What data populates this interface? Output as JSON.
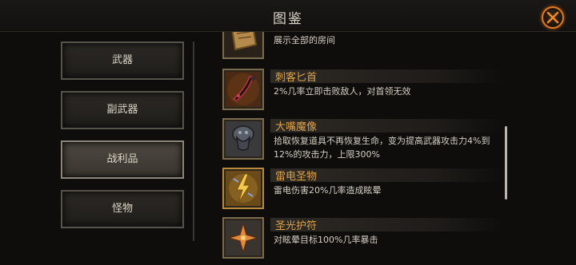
{
  "header": {
    "title": "图鉴"
  },
  "menu": {
    "items": [
      {
        "label": "武器",
        "active": false
      },
      {
        "label": "副武器",
        "active": false
      },
      {
        "label": "战利品",
        "active": true
      },
      {
        "label": "怪物",
        "active": false
      }
    ]
  },
  "list": {
    "partial_desc": "展示全部的房间",
    "items": [
      {
        "name": "刺客匕首",
        "icon": "dagger-icon",
        "desc": "2%几率立即击败敌人，对首领无效"
      },
      {
        "name": "大嘴魔像",
        "icon": "golem-icon",
        "desc": "拾取恢复道具不再恢复生命，变为提高武器攻击力4%到12%的攻击力，上限300%"
      },
      {
        "name": "雷电圣物",
        "icon": "lightning-relic-icon",
        "desc": "雷电伤害20%几率造成眩晕"
      },
      {
        "name": "圣光护符",
        "icon": "holy-amulet-icon",
        "desc": "对眩晕目标100%几率暴击"
      }
    ]
  },
  "colors": {
    "item_name": "#e0a24a",
    "close_ring": "#e07a1c"
  }
}
